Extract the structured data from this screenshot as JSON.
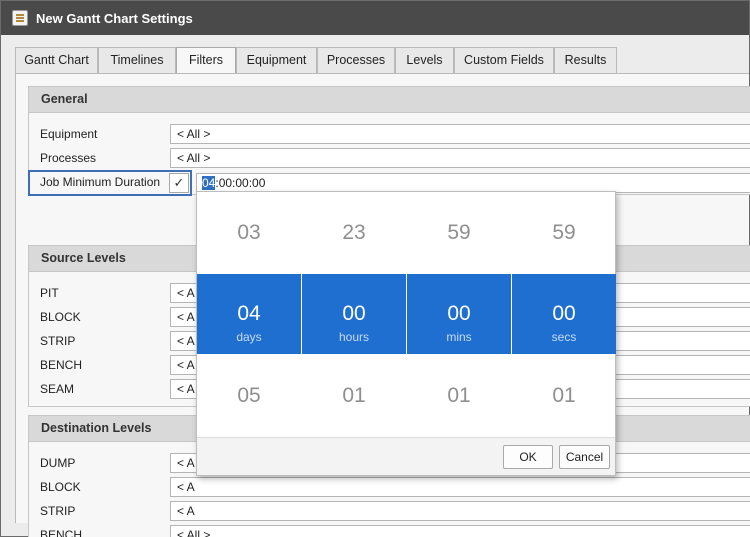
{
  "window": {
    "title": "New Gantt Chart Settings",
    "icon": "chart-settings-icon"
  },
  "tabs": [
    {
      "label": "Gantt Chart"
    },
    {
      "label": "Timelines"
    },
    {
      "label": "Filters",
      "active": true
    },
    {
      "label": "Equipment"
    },
    {
      "label": "Processes"
    },
    {
      "label": "Levels"
    },
    {
      "label": "Custom Fields"
    },
    {
      "label": "Results"
    }
  ],
  "general": {
    "header": "General",
    "equipment": {
      "label": "Equipment",
      "value": "< All >"
    },
    "processes": {
      "label": "Processes",
      "value": "< All >"
    },
    "job_min_duration": {
      "label": "Job Minimum Duration",
      "checked": true,
      "check_glyph": "✓",
      "value_selected": "04",
      "value_rest": ":00:00:00"
    }
  },
  "source_levels": {
    "header": "Source Levels",
    "rows": [
      {
        "label": "PIT",
        "value": "< A"
      },
      {
        "label": "BLOCK",
        "value": "< A"
      },
      {
        "label": "STRIP",
        "value": "< A"
      },
      {
        "label": "BENCH",
        "value": "< A"
      },
      {
        "label": "SEAM",
        "value": "< A"
      }
    ]
  },
  "destination_levels": {
    "header": "Destination Levels",
    "rows": [
      {
        "label": "DUMP",
        "value": "< A"
      },
      {
        "label": "BLOCK",
        "value": "< A"
      },
      {
        "label": "STRIP",
        "value": "< A"
      },
      {
        "label": "BENCH",
        "value": "< All >"
      }
    ]
  },
  "duration_picker": {
    "columns": [
      {
        "prev": "03",
        "value": "04",
        "next": "05",
        "unit": "days"
      },
      {
        "prev": "23",
        "value": "00",
        "next": "01",
        "unit": "hours"
      },
      {
        "prev": "59",
        "value": "00",
        "next": "01",
        "unit": "mins"
      },
      {
        "prev": "59",
        "value": "00",
        "next": "01",
        "unit": "secs"
      }
    ],
    "ok_label": "OK",
    "cancel_label": "Cancel",
    "selection_color": "#1f6fd1"
  }
}
